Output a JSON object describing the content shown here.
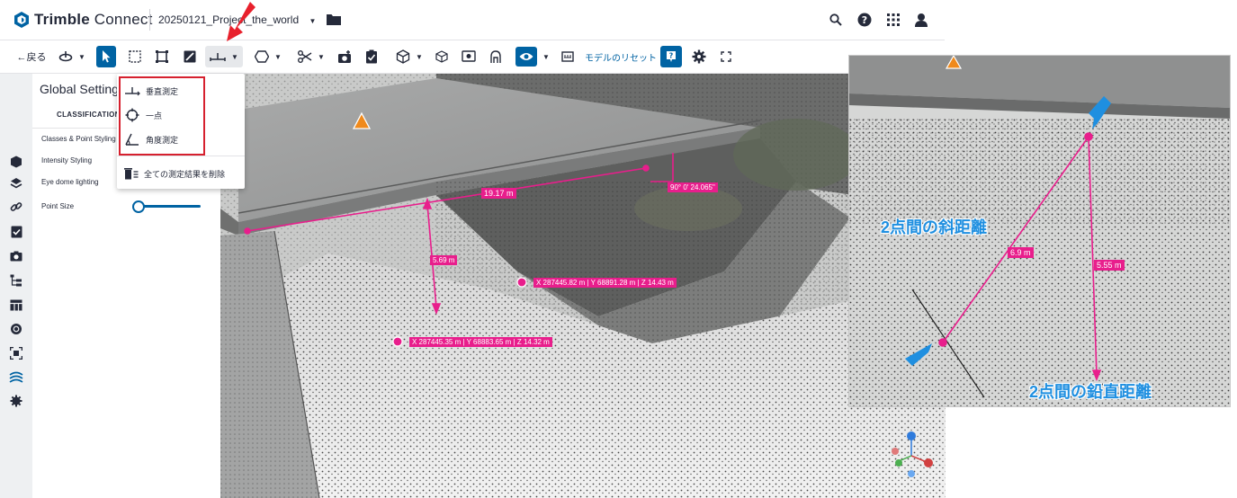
{
  "header": {
    "app_title_bold": "Trimble",
    "app_title_rest": " Connect",
    "project_name": "20250121_Project_the_world"
  },
  "toolbar": {
    "back_label": "←戻る",
    "reset_label": "モデルのリセット"
  },
  "panel": {
    "title": "Global Settings",
    "tab": "CLASSIFICATION",
    "settings": [
      "Classes & Point Styling",
      "Intensity Styling",
      "Eye dome lighting",
      "Point Size"
    ],
    "point_size_level": 0.08
  },
  "measure_menu": {
    "items": [
      "垂直測定",
      "一点",
      "角度測定"
    ],
    "delete_all": "全ての測定結果を削除"
  },
  "viewport": {
    "labels": {
      "horizontal_distance": "19.17 m",
      "angle": "90° 0' 24.065\"",
      "vertical_distance": "5.69 m",
      "point_a": "X 287445.82 m | Y 68891.28 m | Z 14.43 m",
      "point_b": "X 287445.35 m | Y 68883.65 m | Z 14.32 m"
    }
  },
  "inset": {
    "slope_distance": "6.9 m",
    "vertical_distance": "5.55 m",
    "slope_caption": "2点間の斜距離",
    "vertical_caption": "2点間の鉛直距離"
  },
  "colors": {
    "accent": "#0063a3",
    "measure": "#e81e8c",
    "highlight": "#d6202e",
    "callout_arrow": "#1f8fe0"
  }
}
